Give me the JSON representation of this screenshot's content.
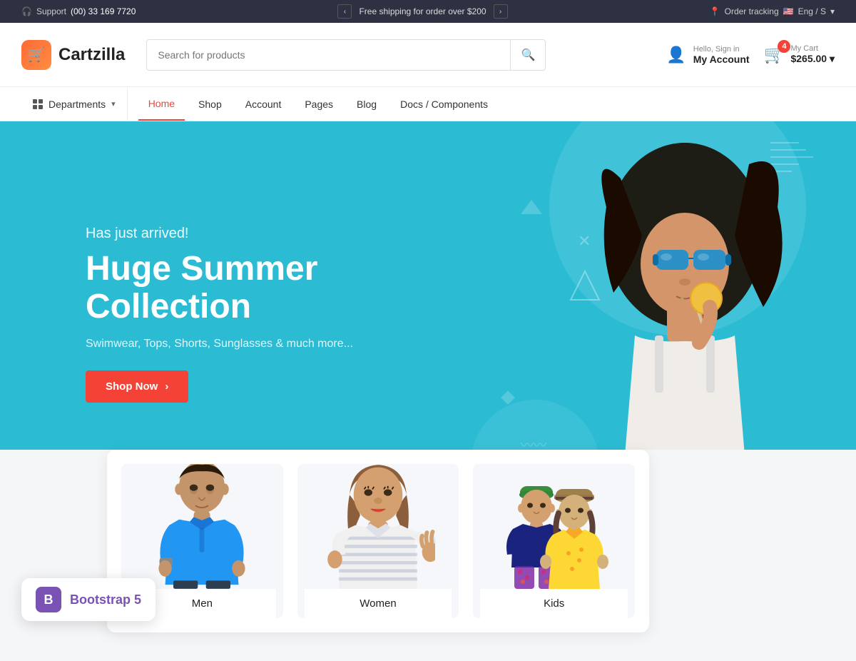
{
  "topbar": {
    "support_label": "Support",
    "support_phone": "(00) 33 169 7720",
    "promo_text": "Free shipping for order over $200",
    "prev_arrow": "‹",
    "next_arrow": "›",
    "order_tracking": "Order tracking",
    "lang": "Eng / S",
    "lang_flag": "🇺🇸"
  },
  "header": {
    "logo_text": "Cartzilla",
    "logo_icon": "🛒",
    "search_placeholder": "Search for products",
    "hello_text": "Hello, Sign in",
    "my_account": "My Account",
    "cart_label": "My Cart",
    "cart_amount": "$265.00",
    "cart_count": "4"
  },
  "nav": {
    "departments_label": "Departments",
    "links": [
      {
        "label": "Home",
        "active": true
      },
      {
        "label": "Shop",
        "active": false
      },
      {
        "label": "Account",
        "active": false
      },
      {
        "label": "Pages",
        "active": false
      },
      {
        "label": "Blog",
        "active": false
      },
      {
        "label": "Docs / Components",
        "active": false
      }
    ]
  },
  "hero": {
    "subtitle": "Has just arrived!",
    "title": "Huge Summer Collection",
    "description": "Swimwear, Tops, Shorts, Sunglasses & much more...",
    "cta_label": "Shop Now",
    "cta_arrow": "›"
  },
  "categories": {
    "items": [
      {
        "label": "Men",
        "color": "#e8ecf0"
      },
      {
        "label": "Women",
        "color": "#e8ecf0"
      },
      {
        "label": "Kids",
        "color": "#e8ecf0"
      }
    ]
  },
  "bootstrap_badge": {
    "icon": "B",
    "label": "Bootstrap 5"
  }
}
